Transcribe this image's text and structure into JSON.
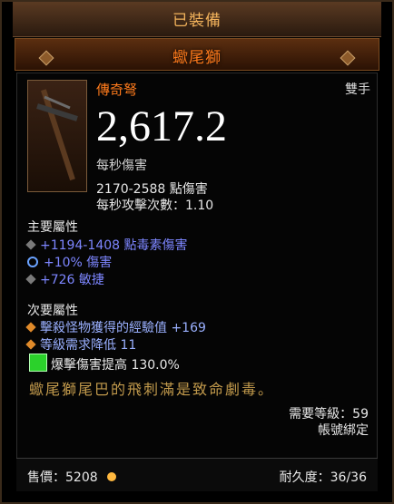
{
  "header": {
    "equipped_label": "已裝備",
    "item_name": "蠍尾獅"
  },
  "item": {
    "type_label": "傳奇弩",
    "slot_label": "雙手",
    "dps": "2,617.2",
    "dps_label": "每秒傷害",
    "damage_range": "2170-2588 點傷害",
    "attack_speed": "每秒攻擊次數：1.10"
  },
  "primary": {
    "title": "主要屬性",
    "stats": [
      "+1194-1408 點毒素傷害",
      "+10% 傷害",
      "+726 敏捷"
    ]
  },
  "secondary": {
    "title": "次要屬性",
    "stats": [
      "擊殺怪物獲得的經驗值 +169",
      "等級需求降低 11"
    ]
  },
  "socket": {
    "text": "爆擊傷害提高 130.0%"
  },
  "flavor": "蠍尾獅尾巴的飛刺滿是致命劇毒。",
  "requirements": {
    "level": "需要等級：59",
    "bound": "帳號綁定"
  },
  "footer": {
    "sell": "售價：5208",
    "durability": "耐久度：36/36"
  }
}
